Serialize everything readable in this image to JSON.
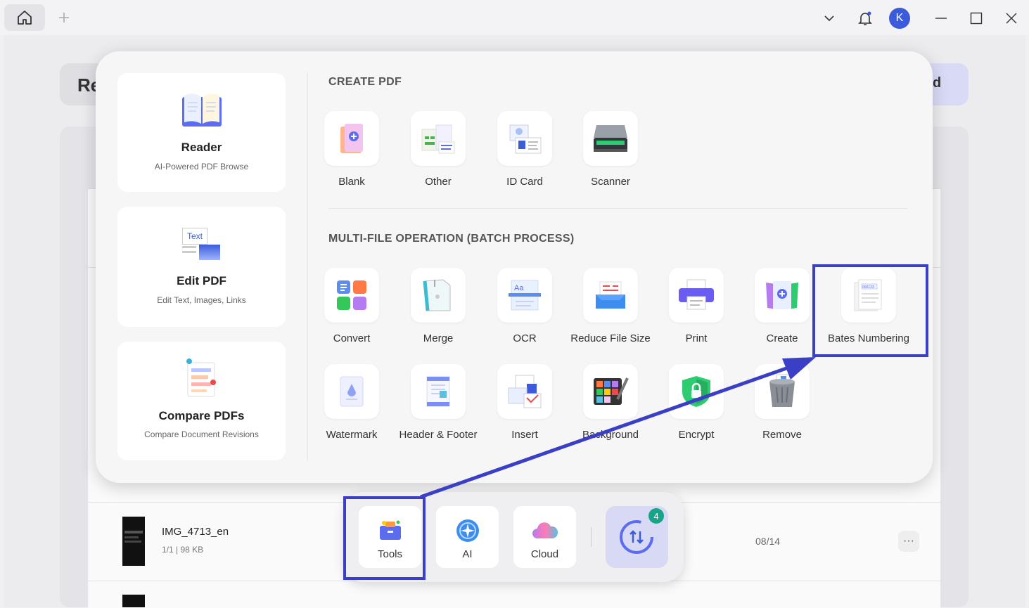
{
  "titlebar": {
    "home_icon": "home-icon",
    "new_tab_icon": "plus-icon",
    "dropdown_icon": "chevron-down-icon",
    "notification_icon": "bell-icon",
    "avatar_letter": "K",
    "minimize_icon": "minimize-icon",
    "maximize_icon": "maximize-icon",
    "close_icon": "close-icon",
    "accent": "#3b5bdb"
  },
  "background": {
    "left_button_text": "Re",
    "right_button_text": "d",
    "file": {
      "name": "IMG_4713_en",
      "meta": "1/1 | 98 KB",
      "date": "08/14",
      "more": "···"
    }
  },
  "sidebar": [
    {
      "title": "Reader",
      "subtitle": "AI-Powered PDF Browse",
      "icon": "book-icon"
    },
    {
      "title": "Edit PDF",
      "subtitle": "Edit Text, Images, Links",
      "icon": "edit-text-icon",
      "icon_text": "Text"
    },
    {
      "title": "Compare PDFs",
      "subtitle": "Compare Document Revisions",
      "icon": "compare-icon"
    }
  ],
  "create_pdf": {
    "title": "CREATE PDF",
    "items": [
      {
        "label": "Blank",
        "icon": "blank-pdf-icon"
      },
      {
        "label": "Other",
        "icon": "other-files-icon"
      },
      {
        "label": "ID Card",
        "icon": "id-card-icon"
      },
      {
        "label": "Scanner",
        "icon": "scanner-icon"
      }
    ]
  },
  "batch": {
    "title": "MULTI-FILE OPERATION (BATCH PROCESS)",
    "row1": [
      {
        "label": "Convert",
        "icon": "convert-icon"
      },
      {
        "label": "Merge",
        "icon": "merge-icon"
      },
      {
        "label": "OCR",
        "icon": "ocr-icon"
      },
      {
        "label": "Reduce File Size",
        "icon": "compress-icon"
      },
      {
        "label": "Print",
        "icon": "print-icon"
      },
      {
        "label": "Create",
        "icon": "create-icon"
      },
      {
        "label": "Bates Numbering",
        "icon": "bates-numbering-icon"
      }
    ],
    "row2": [
      {
        "label": "Watermark",
        "icon": "watermark-icon"
      },
      {
        "label": "Header & Footer",
        "icon": "header-footer-icon"
      },
      {
        "label": "Insert",
        "icon": "insert-icon"
      },
      {
        "label": "Background",
        "icon": "background-icon"
      },
      {
        "label": "Encrypt",
        "icon": "encrypt-icon"
      },
      {
        "label": "Remove",
        "icon": "trash-icon"
      }
    ]
  },
  "dock": {
    "tools_label": "Tools",
    "ai_label": "AI",
    "cloud_label": "Cloud",
    "convert_badge": "4"
  },
  "annotation_color": "#3a3fc5"
}
